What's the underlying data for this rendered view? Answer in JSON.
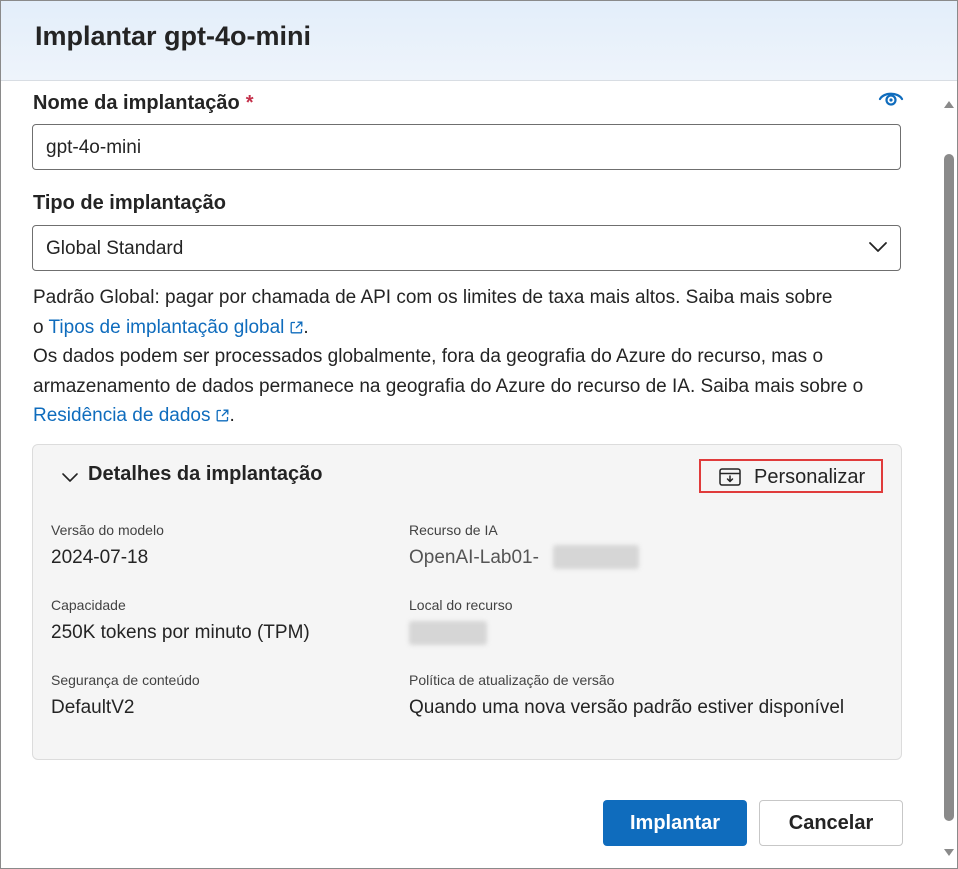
{
  "dialog": {
    "title": "Implantar gpt-4o-mini"
  },
  "deployment_name": {
    "label": "Nome da implantação",
    "required_mark": "*",
    "value": "gpt-4o-mini"
  },
  "deployment_type": {
    "label": "Tipo de implantação",
    "selected": "Global Standard"
  },
  "description": {
    "line1": "Padrão Global: pagar por chamada de API com os limites de taxa mais altos. Saiba mais sobre",
    "prefix1": "o",
    "link1": "Tipos de implantação global",
    "suffix1": ".",
    "para2": "Os dados podem ser processados globalmente, fora da geografia do Azure do recurso, mas o armazenamento de dados permanece na geografia do Azure do recurso de IA. Saiba mais sobre o",
    "link2": "Residência de dados",
    "suffix2": "."
  },
  "details": {
    "title": "Detalhes da implantação",
    "customize_label": "Personalizar",
    "model_version": {
      "label": "Versão do modelo",
      "value": "2024-07-18"
    },
    "ai_resource": {
      "label": "Recurso de IA",
      "value": "OpenAI-Lab01-"
    },
    "capacity": {
      "label": "Capacidade",
      "value": "250K tokens por minuto (TPM)"
    },
    "resource_location": {
      "label": "Local do recurso"
    },
    "content_safety": {
      "label": "Segurança de conteúdo",
      "value": "DefaultV2"
    },
    "version_update_policy": {
      "label": "Política de atualização de versão",
      "value": "Quando uma nova versão padrão estiver disponível"
    }
  },
  "footer": {
    "deploy_label": "Implantar",
    "cancel_label": "Cancelar"
  },
  "colors": {
    "primary": "#0f6cbd",
    "link": "#0f6cbd",
    "required": "#c4314b",
    "highlight": "#e03b3b"
  },
  "icons": [
    "eye-icon",
    "chevron-down-icon",
    "external-link-icon",
    "customize-icon"
  ]
}
